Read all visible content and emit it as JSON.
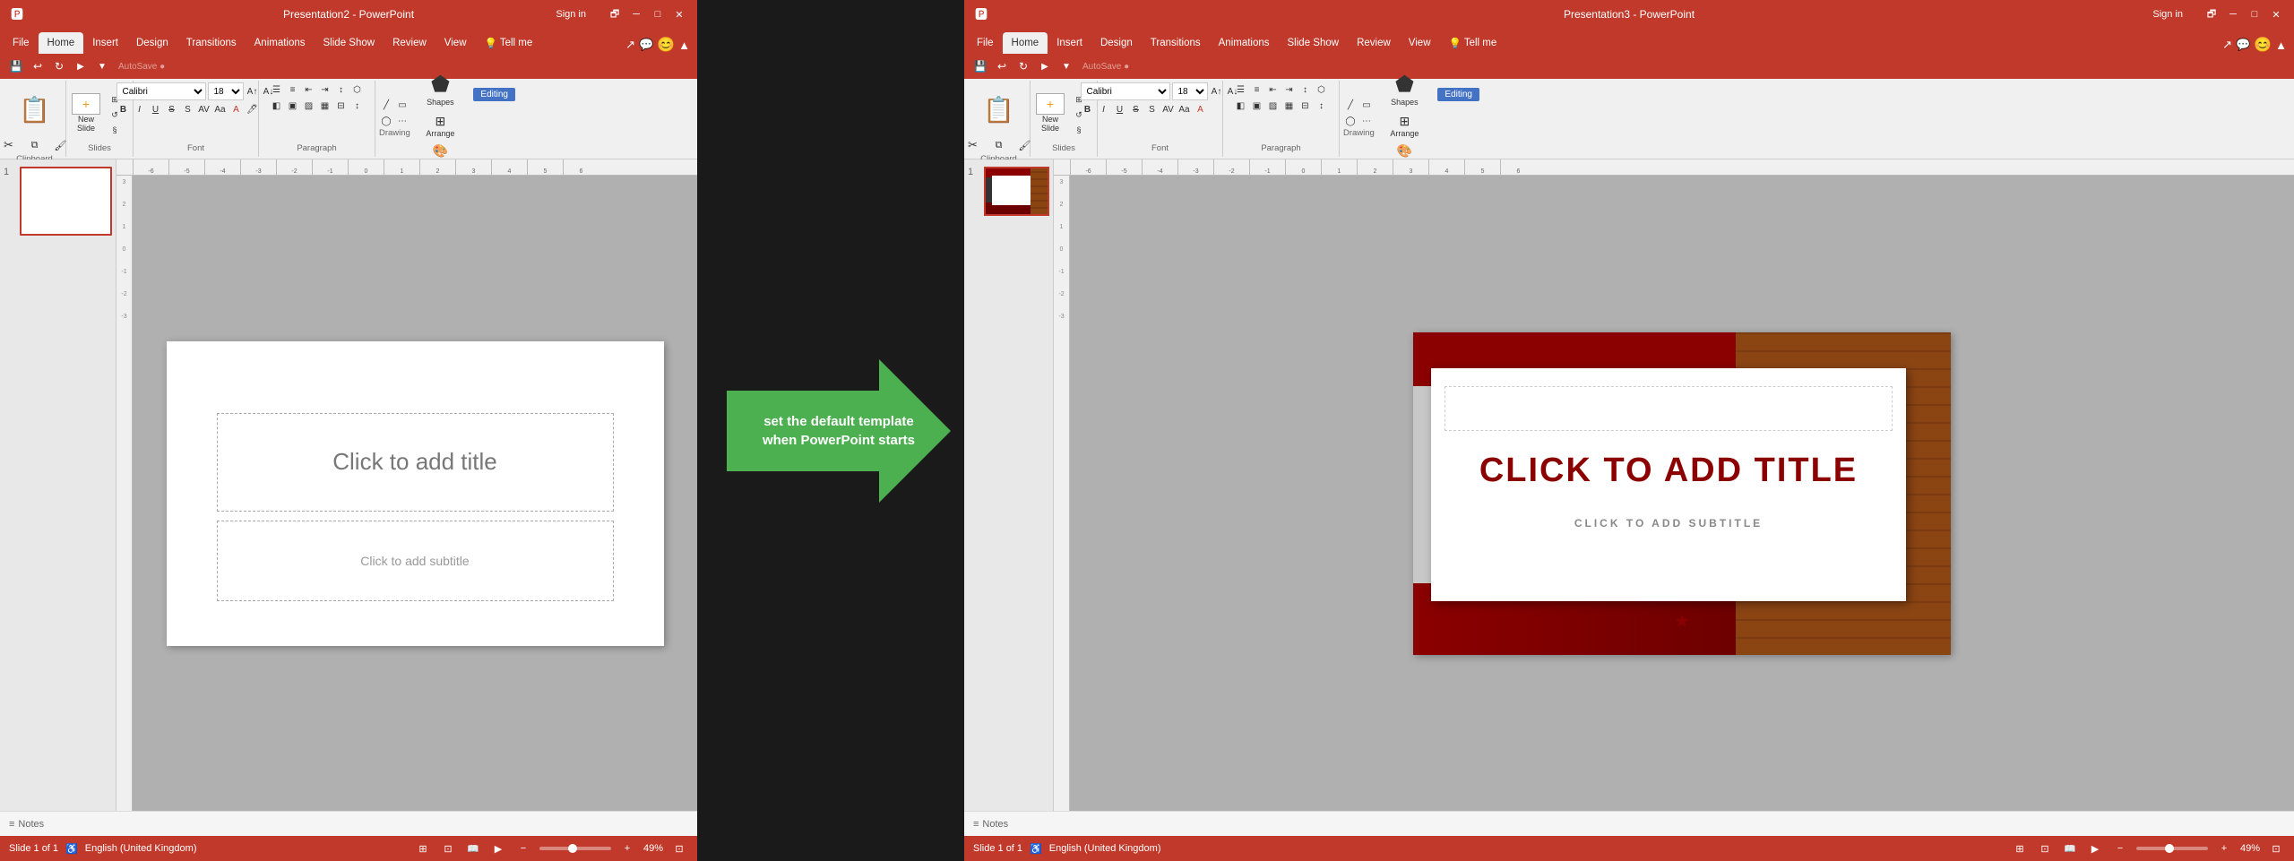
{
  "left_window": {
    "title": "Presentation2 - PowerPoint",
    "sign_in": "Sign in",
    "tabs": [
      "File",
      "Home",
      "Insert",
      "Design",
      "Transitions",
      "Animations",
      "Slide Show",
      "Review",
      "View",
      "Tell me"
    ],
    "active_tab": "Home",
    "qat_buttons": [
      "save",
      "undo",
      "redo",
      "start-from-beginning",
      "customize"
    ],
    "ribbon": {
      "clipboard_label": "Clipboard",
      "slides_label": "Slides",
      "font_label": "Font",
      "paragraph_label": "Paragraph",
      "drawing_label": "Drawing",
      "editing_label": "Editing",
      "paste_label": "Paste",
      "new_slide_label": "New Slide",
      "shapes_label": "Shapes",
      "arrange_label": "Arrange",
      "quick_styles_label": "Quick Styles"
    },
    "slide": {
      "number": "1",
      "title_placeholder": "Click to add title",
      "subtitle_placeholder": "Click to add subtitle"
    },
    "status": {
      "slide_info": "Slide 1 of 1",
      "language": "English (United Kingdom)",
      "notes_label": "Notes",
      "zoom": "49%"
    }
  },
  "right_window": {
    "title": "Presentation3 - PowerPoint",
    "sign_in": "Sign in",
    "tabs": [
      "File",
      "Home",
      "Insert",
      "Design",
      "Transitions",
      "Animations",
      "Slide Show",
      "Review",
      "View",
      "Tell me"
    ],
    "active_tab": "Home",
    "ribbon": {
      "clipboard_label": "Clipboard",
      "slides_label": "Slides",
      "font_label": "Font",
      "paragraph_label": "Paragraph",
      "drawing_label": "Drawing",
      "editing_label": "Editing",
      "paste_label": "Paste",
      "new_slide_label": "New Slide",
      "shapes_label": "Shapes",
      "arrange_label": "Arrange",
      "quick_styles_label": "Quick Styles"
    },
    "slide": {
      "number": "1",
      "title_text": "CLICK TO ADD TITLE",
      "subtitle_text": "CLICK TO ADD SUBTITLE"
    },
    "status": {
      "slide_info": "Slide 1 of 1",
      "language": "English (United Kingdom)",
      "notes_label": "Notes",
      "zoom": "49%"
    }
  },
  "arrow": {
    "text": "set the default template when PowerPoint starts"
  },
  "colors": {
    "accent": "#c0392b",
    "green_arrow": "#4caf50",
    "editing_badge": "#4472c4"
  }
}
